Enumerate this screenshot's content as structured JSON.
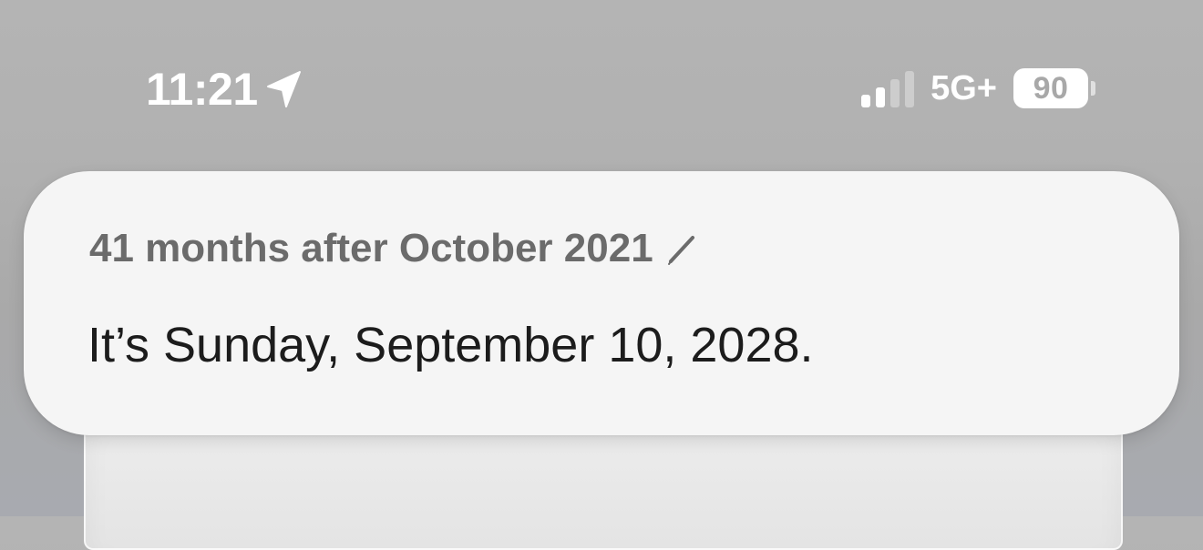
{
  "status_bar": {
    "time": "11:21",
    "location_icon": "location-arrow-icon",
    "signal_bars_active": 2,
    "signal_bars_total": 4,
    "network": "5G+",
    "battery_level": "90"
  },
  "siri_card": {
    "query": "41 months after October 2021",
    "edit_icon": "pencil-icon",
    "answer": "It’s Sunday, September 10, 2028."
  },
  "colors": {
    "background": "#b1b1b1",
    "card": "#f5f5f5",
    "query_text": "#6b6b6b",
    "answer_text": "#1c1c1c"
  }
}
